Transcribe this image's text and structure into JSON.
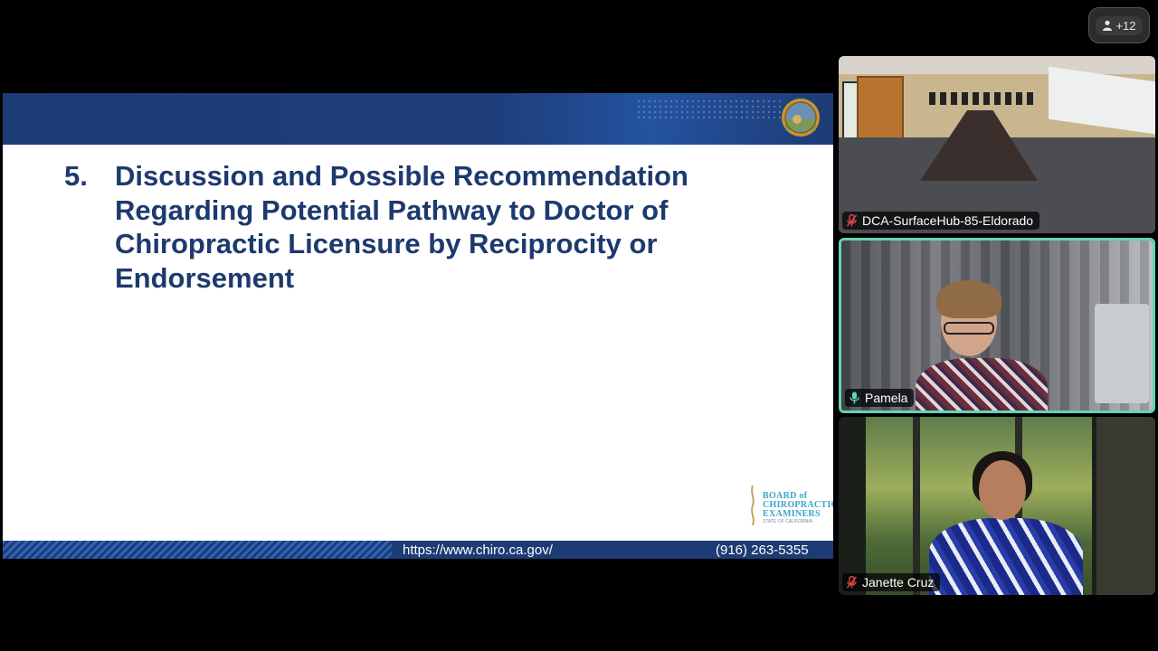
{
  "participants_overflow": {
    "label": "+12",
    "icon": "person-icon"
  },
  "slide": {
    "item_number": "5.",
    "title": "Discussion and Possible Recommendation Regarding Potential Pathway to Doctor of Chiropractic Licensure by Reciprocity or Endorsement",
    "logo": {
      "line1": "BOARD of",
      "line2": "CHIROPRACTIC",
      "line3": "EXAMINERS",
      "line4": "STATE OF CALIFORNIA"
    },
    "footer_url": "https://www.chiro.ca.gov/",
    "footer_phone": "(916) 263-5355",
    "colors": {
      "header": "#1d3b74",
      "title": "#1d3a6e",
      "logo": "#3aa7c7"
    }
  },
  "video_tiles": [
    {
      "name": "DCA-SurfaceHub-85-Eldorado",
      "mic": "muted",
      "mic_icon": "mic-muted-icon",
      "speaking": false
    },
    {
      "name": "Pamela",
      "mic": "active",
      "mic_icon": "mic-active-icon",
      "speaking": true
    },
    {
      "name": "Janette Cruz",
      "mic": "muted",
      "mic_icon": "mic-muted-icon",
      "speaking": false
    }
  ],
  "accent_colors": {
    "speaking_border": "#5fd6b3",
    "muted": "#e0464b",
    "active_mic": "#5fd6b3"
  }
}
